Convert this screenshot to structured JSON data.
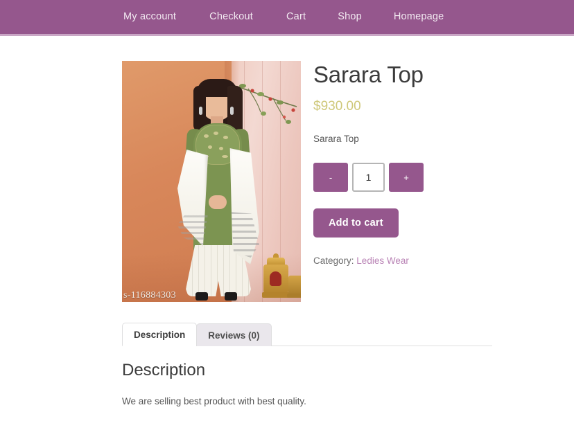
{
  "nav": {
    "items": [
      {
        "label": "My account",
        "name": "nav-my-account"
      },
      {
        "label": "Checkout",
        "name": "nav-checkout"
      },
      {
        "label": "Cart",
        "name": "nav-cart"
      },
      {
        "label": "Shop",
        "name": "nav-shop"
      },
      {
        "label": "Homepage",
        "name": "nav-homepage"
      }
    ],
    "background_color": "#95578d",
    "link_color": "#f2e9f1"
  },
  "product": {
    "title": "Sarara Top",
    "price": "$930.00",
    "price_color": "#cfc87a",
    "short_description": "Sarara Top",
    "image_watermark": "s-116884303",
    "quantity": {
      "decrease_label": "-",
      "increase_label": "+",
      "value": "1"
    },
    "add_to_cart_label": "Add to cart",
    "meta": {
      "category_label": "Category:",
      "category_value": "Ledies Wear",
      "category_link_color": "#b983b5"
    },
    "accent_color": "#95578d"
  },
  "tabs": [
    {
      "label": "Description",
      "active": true
    },
    {
      "label": "Reviews (0)",
      "active": false
    }
  ],
  "description_panel": {
    "heading": "Description",
    "body": "We are selling best product with best quality."
  }
}
